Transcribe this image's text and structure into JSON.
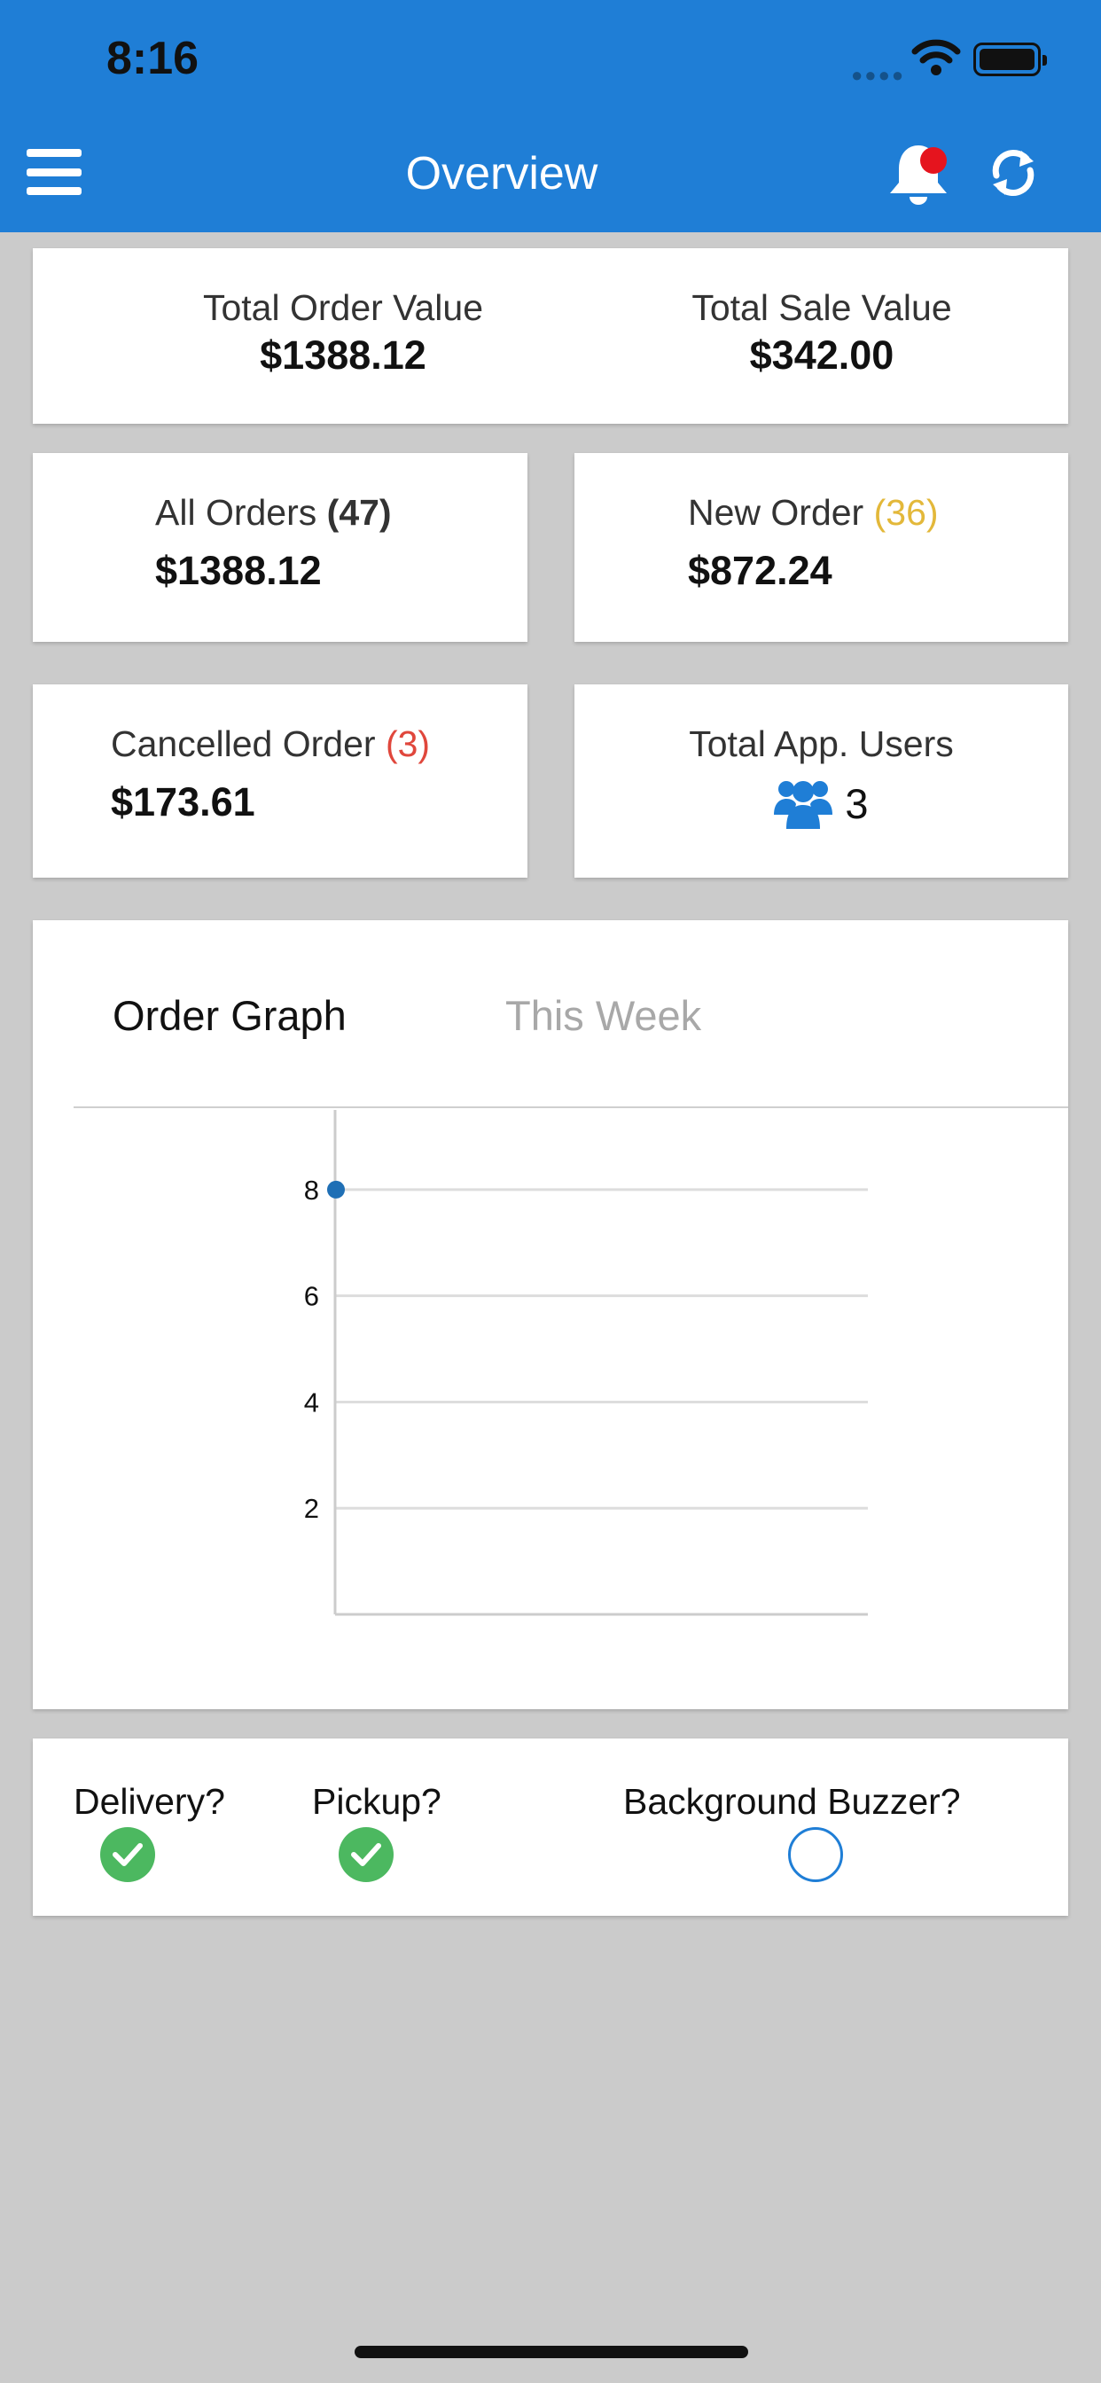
{
  "status_bar": {
    "time": "8:16"
  },
  "nav": {
    "title": "Overview",
    "menu_icon": "hamburger-icon",
    "bell_icon": "bell-icon",
    "refresh_icon": "refresh-icon"
  },
  "totals": {
    "order_label": "Total Order Value",
    "order_value": "$1388.12",
    "sale_label": "Total Sale Value",
    "sale_value": "$342.00"
  },
  "all_orders": {
    "label": "All Orders",
    "count": "(47)",
    "value": "$1388.12"
  },
  "new_order": {
    "label": "New Order",
    "count": "(36)",
    "value": "$872.24"
  },
  "cancelled_order": {
    "label": "Cancelled Order",
    "count": "(3)",
    "value": "$173.61"
  },
  "app_users": {
    "label": "Total App. Users",
    "value": "3",
    "icon": "users-icon"
  },
  "graph": {
    "title": "Order Graph",
    "period": "This Week"
  },
  "chart_data": {
    "type": "line",
    "x": [
      0
    ],
    "series": [
      {
        "values": [
          8
        ]
      }
    ],
    "y_ticks": [
      2,
      4,
      6,
      8
    ],
    "ylim": [
      0,
      9
    ],
    "grid": true,
    "color": "#1f6fb5"
  },
  "toggles": {
    "delivery": {
      "label": "Delivery?",
      "checked": true
    },
    "pickup": {
      "label": "Pickup?",
      "checked": true
    },
    "buzzer": {
      "label": "Background Buzzer?",
      "checked": false
    }
  },
  "colors": {
    "primary": "#1f7ed6",
    "success": "#4cb860",
    "warning": "#e3b83a",
    "danger": "#e0473c",
    "background": "#cbcbcb"
  }
}
